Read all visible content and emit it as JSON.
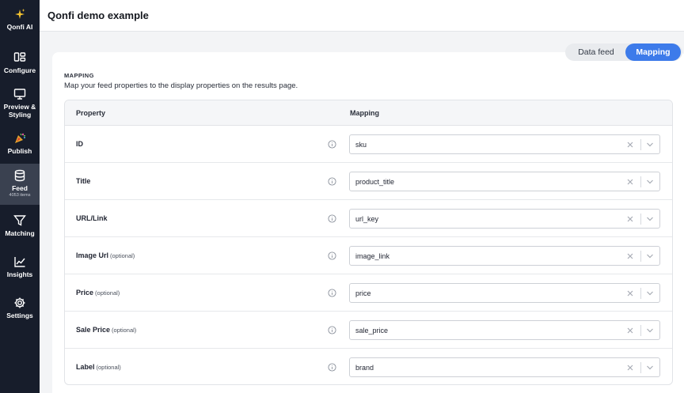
{
  "app": {
    "title": "Qonfi demo example"
  },
  "sidebar": {
    "items": [
      {
        "label": "Qonfi AI",
        "icon": "sparkles-icon"
      },
      {
        "label": "Configure",
        "icon": "layout-icon"
      },
      {
        "label": "Preview &",
        "label2": "Styling",
        "icon": "monitor-icon"
      },
      {
        "label": "Publish",
        "icon": "party-popper-icon"
      },
      {
        "label": "Feed",
        "sub": "4053 items",
        "icon": "database-icon",
        "active": true
      },
      {
        "label": "Matching",
        "icon": "filter-icon"
      },
      {
        "label": "Insights",
        "icon": "chart-line-icon"
      },
      {
        "label": "Settings",
        "icon": "gear-icon"
      }
    ]
  },
  "tabs": {
    "data_feed": "Data feed",
    "mapping": "Mapping",
    "active": "Mapping"
  },
  "section": {
    "title": "MAPPING",
    "description": "Map your feed properties to the display properties on the results page."
  },
  "table": {
    "headers": {
      "property": "Property",
      "mapping": "Mapping"
    },
    "rows": [
      {
        "property": "ID",
        "optional": "",
        "value": "sku"
      },
      {
        "property": "Title",
        "optional": "",
        "value": "product_title"
      },
      {
        "property": "URL/Link",
        "optional": "",
        "value": "url_key"
      },
      {
        "property": "Image Url",
        "optional": "(optional)",
        "value": "image_link"
      },
      {
        "property": "Price",
        "optional": "(optional)",
        "value": "price"
      },
      {
        "property": "Sale Price",
        "optional": "(optional)",
        "value": "sale_price"
      },
      {
        "property": "Label",
        "optional": "(optional)",
        "value": "brand"
      }
    ]
  },
  "colors": {
    "sidebar_bg": "#171d2b",
    "sidebar_active": "#3a4150",
    "accent": "#3d7bea",
    "sparkle": "#f2c230"
  }
}
